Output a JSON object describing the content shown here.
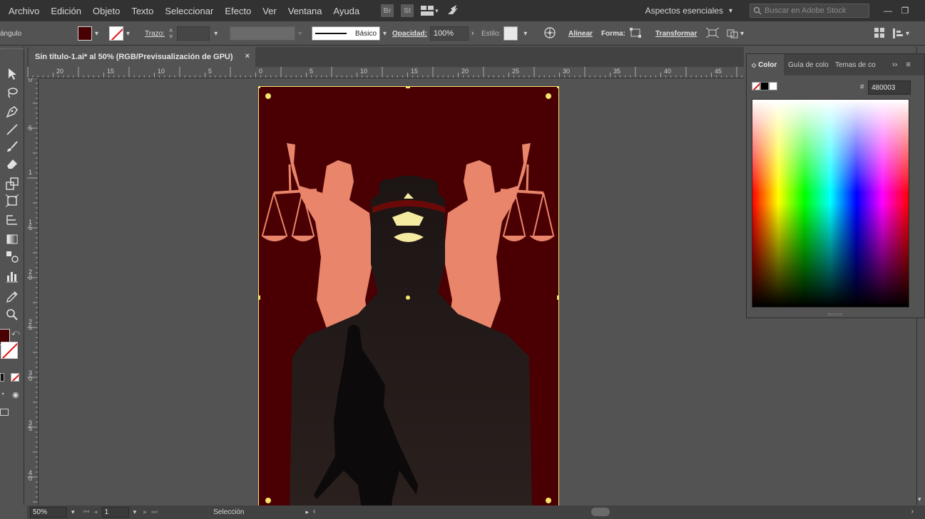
{
  "menu": {
    "items": [
      "Archivo",
      "Edición",
      "Objeto",
      "Texto",
      "Seleccionar",
      "Efecto",
      "Ver",
      "Ventana",
      "Ayuda"
    ],
    "bridge": "Br",
    "stock": "St"
  },
  "workspace": {
    "label": "Aspectos esenciales"
  },
  "stock_search": {
    "placeholder": "Buscar en Adobe Stock"
  },
  "control": {
    "tool_name": "ángulo",
    "stroke_label": "Trazo:",
    "stroke_style": "Básico",
    "opacity_label": "Opacidad:",
    "opacity_value": "100%",
    "style_label": "Estilo:",
    "align_label": "Alinear",
    "shape_label": "Forma:",
    "transform_label": "Transformar"
  },
  "document": {
    "tab_title": "Sin título-1.ai* al 50% (RGB/Previsualización de GPU)",
    "close": "×"
  },
  "ruler": {
    "top": [
      "20",
      "15",
      "10",
      "5",
      "0",
      "5",
      "10",
      "15",
      "20",
      "25",
      "30",
      "35",
      "40",
      "45"
    ],
    "left": [
      "0",
      "5",
      "1",
      "1 5",
      "2 0",
      "2 5",
      "3 0",
      "3 5",
      "4 0"
    ]
  },
  "status": {
    "zoom": "50%",
    "page": "1",
    "tool": "Selección"
  },
  "color_panel": {
    "tabs": [
      "Color",
      "Guía de colo",
      "Temas de co"
    ],
    "hex_label": "#",
    "hex_value": "480003"
  },
  "colors": {
    "artboard_bg": "#4a0003",
    "figure": "#e8856a",
    "hero_dark": "#251b1a",
    "silhouette": "#0c0a0a",
    "highlight": "#f4eaa0",
    "selection": "#f7e46c"
  }
}
